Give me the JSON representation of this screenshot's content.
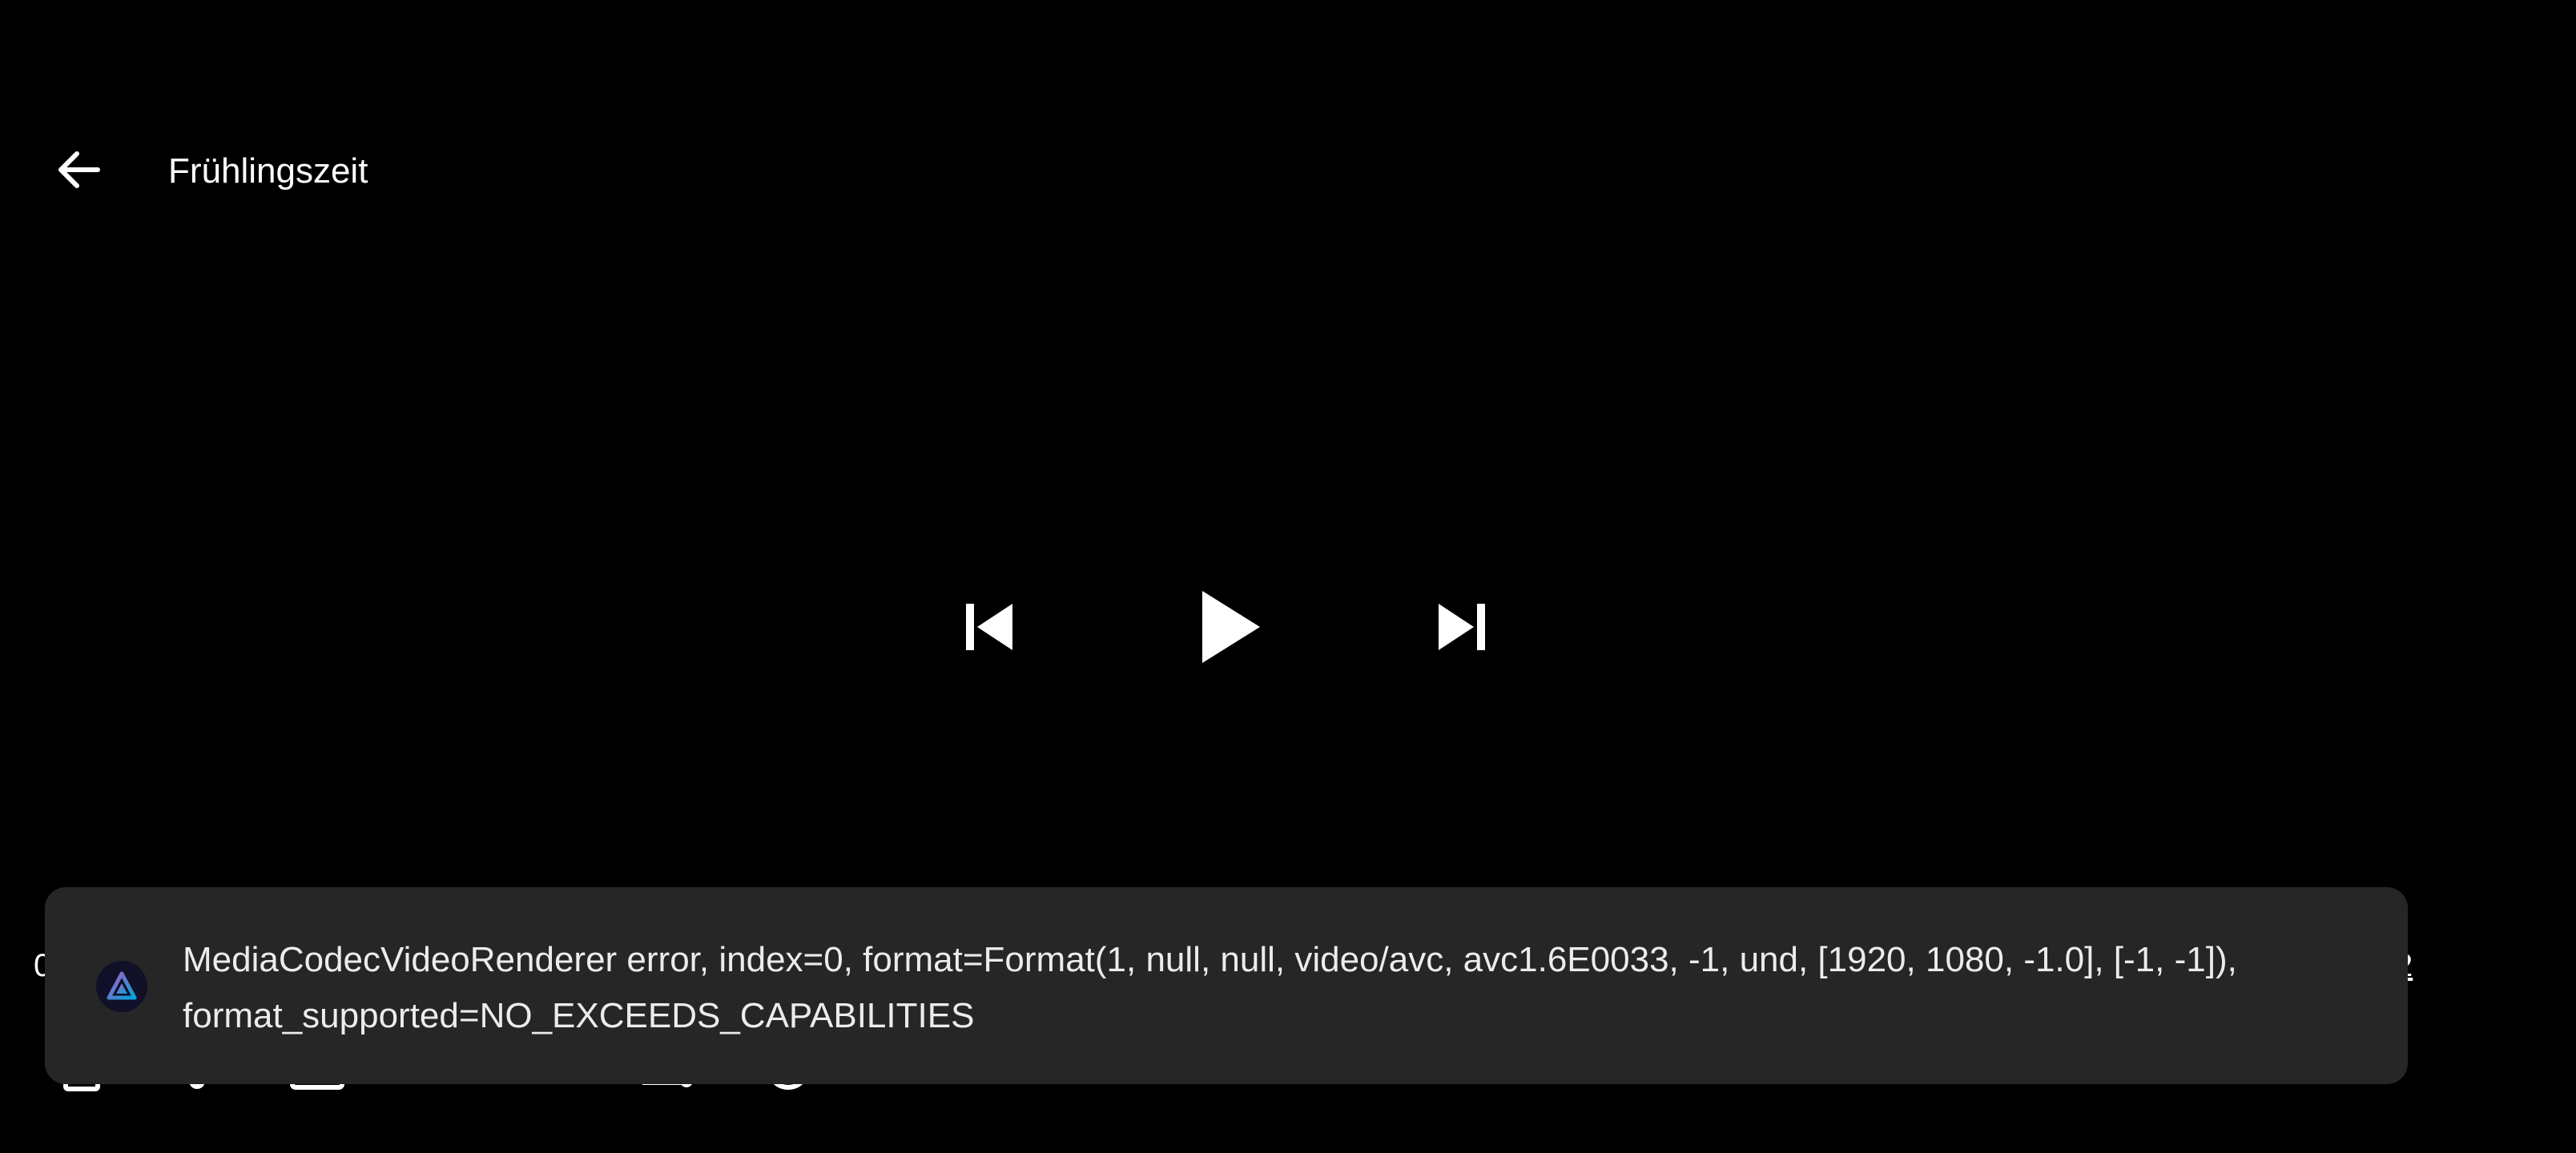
{
  "header": {
    "back_icon": "arrow-left-icon",
    "title": "Frühlingszeit"
  },
  "transport": {
    "previous_icon": "skip-previous-icon",
    "play_icon": "play-icon",
    "next_icon": "skip-next-icon"
  },
  "progress": {
    "position_text": "0",
    "duration_text": "2"
  },
  "toast": {
    "app_icon": "jellyfin-app-icon",
    "message": "MediaCodecVideoRenderer error, index=0, format=Format(1, null, null, video/avc, avc1.6E0033, -1, und, [1920, 1080, -1.0], [-1, -1]), format_supported=NO_EXCEEDS_CAPABILITIES"
  },
  "colors": {
    "background": "#000000",
    "toast_background": "#262626",
    "text": "#ffffff",
    "toast_text": "#ececec",
    "app_icon_accent": "#8a6cf0"
  }
}
